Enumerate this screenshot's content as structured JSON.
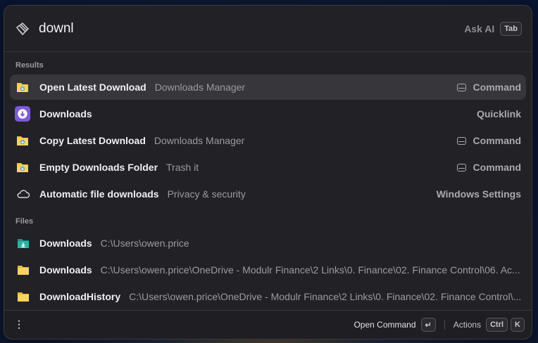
{
  "search": {
    "query": "downl",
    "ask_ai_label": "Ask AI",
    "ask_ai_key": "Tab"
  },
  "sections": {
    "results_title": "Results",
    "files_title": "Files"
  },
  "results": [
    {
      "title": "Open Latest Download",
      "subtitle": "Downloads Manager",
      "accessory": "Command",
      "icon": "folder-download-icon",
      "selected": true
    },
    {
      "title": "Downloads",
      "subtitle": "",
      "accessory": "Quicklink",
      "icon": "download-circle-icon",
      "selected": false
    },
    {
      "title": "Copy Latest Download",
      "subtitle": "Downloads Manager",
      "accessory": "Command",
      "icon": "folder-download-icon",
      "selected": false
    },
    {
      "title": "Empty Downloads Folder",
      "subtitle": "Trash it",
      "accessory": "Command",
      "icon": "folder-download-icon",
      "selected": false
    },
    {
      "title": "Automatic file downloads",
      "subtitle": "Privacy & security",
      "accessory": "Windows Settings",
      "icon": "cloud-icon",
      "selected": false
    }
  ],
  "files": [
    {
      "title": "Downloads",
      "path": "C:\\Users\\owen.price",
      "icon": "download-folder-icon"
    },
    {
      "title": "Downloads",
      "path": "C:\\Users\\owen.price\\OneDrive - Modulr Finance\\2 Links\\0. Finance\\02. Finance Control\\06. Ac...",
      "icon": "folder-icon"
    },
    {
      "title": "DownloadHistory",
      "path": "C:\\Users\\owen.price\\OneDrive - Modulr Finance\\2 Links\\0. Finance\\02. Finance Control\\...",
      "icon": "folder-icon"
    }
  ],
  "footer": {
    "menu_glyph": "⋮",
    "primary_action": "Open Command",
    "primary_key": "↵",
    "actions_label": "Actions",
    "actions_key1": "Ctrl",
    "actions_key2": "K"
  },
  "colors": {
    "folder_yellow": "#f2c744",
    "quicklink_purple": "#7c5cd6",
    "download_teal": "#2bb3a3"
  }
}
